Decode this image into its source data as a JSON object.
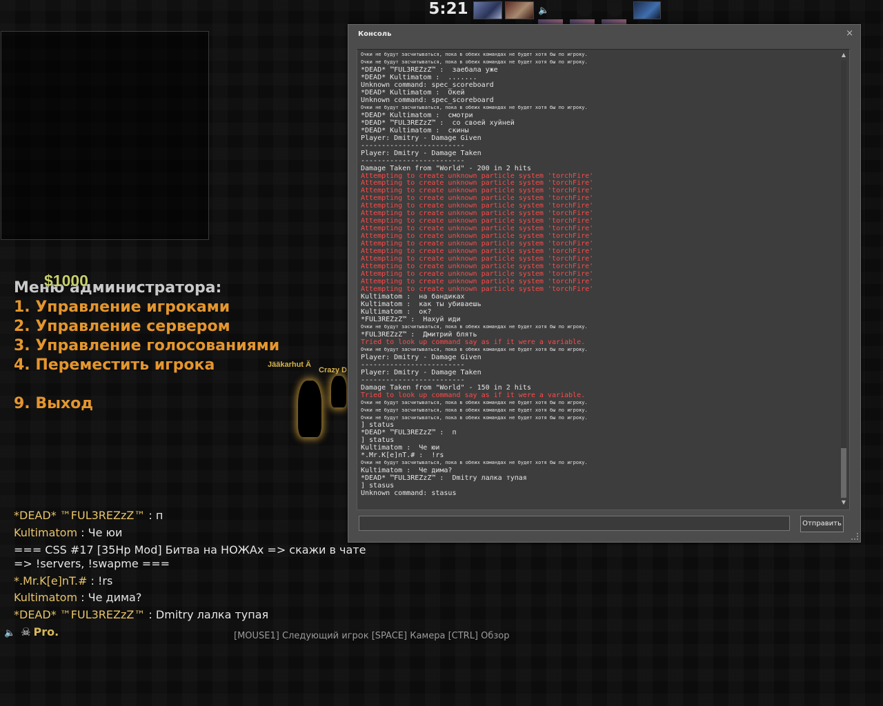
{
  "hud": {
    "timer": "5:21",
    "money": "$1000"
  },
  "admin_menu": {
    "title": "Меню администратора:",
    "items": [
      "1. Управление игроками",
      "2. Управление сервером",
      "3. Управление голосованиями",
      "4. Переместить игрока",
      "9. Выход"
    ]
  },
  "player_tags": [
    "Jääkarhut Ä",
    "Crazy D"
  ],
  "chat": {
    "lines": [
      {
        "name": "*DEAD* ™FUL3REZzZ™",
        "sep": " :  ",
        "text": "п"
      },
      {
        "name": "Kultimatom",
        "sep": " :  ",
        "text": "Че юи"
      },
      {
        "name": "",
        "sep": "",
        "text": "=== CSS #17 [35Hp Mod] Битва на НОЖАх => скажи в чате"
      },
      {
        "name": "",
        "sep": "",
        "text": "=> !servers, !swapme ==="
      },
      {
        "name": "*.Mr.K[e]nT.#",
        "sep": " :  ",
        "text": "!rs"
      },
      {
        "name": "Kultimatom",
        "sep": " :  ",
        "text": "Че дима?"
      },
      {
        "name": "*DEAD* ™FUL3REZzZ™",
        "sep": " :  ",
        "text": "Dmitry лалка тупая"
      }
    ],
    "voice_speaker": "Pro.",
    "controls_hint": "[MOUSE1] Следующий игрок [SPACE] Камера [CTRL] Обзор"
  },
  "console": {
    "title": "Консоль",
    "close_label": "×",
    "send_label": "Отправить",
    "input_value": "",
    "log": [
      {
        "text": "Очки не будут засчитываться, пока в обеих командах не будет хотя бы по игроку.",
        "style": "small"
      },
      {
        "text": "Очки не будут засчитываться, пока в обеих командах не будет хотя бы по игроку.",
        "style": "small"
      },
      {
        "text": "*DEAD* ™FUL3REZzZ™ :  заебала уже",
        "style": ""
      },
      {
        "text": "*DEAD* Kultimatom :  .......",
        "style": ""
      },
      {
        "text": "Unknown command: spec_scoreboard",
        "style": ""
      },
      {
        "text": "*DEAD* Kultimatom :  Окей",
        "style": ""
      },
      {
        "text": "Unknown command: spec_scoreboard",
        "style": ""
      },
      {
        "text": "Очки не будут засчитываться, пока в обеих командах не будет хотя бы по игроку.",
        "style": "small"
      },
      {
        "text": "*DEAD* Kultimatom :  смотри",
        "style": ""
      },
      {
        "text": "*DEAD* ™FUL3REZzZ™ :  со своей хуйней",
        "style": ""
      },
      {
        "text": "*DEAD* Kultimatom :  скины",
        "style": ""
      },
      {
        "text": "Player: Dmitry - Damage Given",
        "style": ""
      },
      {
        "text": "-------------------------",
        "style": ""
      },
      {
        "text": "Player: Dmitry - Damage Taken",
        "style": ""
      },
      {
        "text": "-------------------------",
        "style": ""
      },
      {
        "text": "Damage Taken from \"World\" - 200 in 2 hits",
        "style": ""
      },
      {
        "text": "Attempting to create unknown particle system 'torchFire'",
        "style": "red"
      },
      {
        "text": "Attempting to create unknown particle system 'torchFire'",
        "style": "red"
      },
      {
        "text": "Attempting to create unknown particle system 'torchFire'",
        "style": "red"
      },
      {
        "text": "Attempting to create unknown particle system 'torchFire'",
        "style": "red"
      },
      {
        "text": "Attempting to create unknown particle system 'torchFire'",
        "style": "red"
      },
      {
        "text": "Attempting to create unknown particle system 'torchFire'",
        "style": "red"
      },
      {
        "text": "Attempting to create unknown particle system 'torchFire'",
        "style": "red"
      },
      {
        "text": "Attempting to create unknown particle system 'torchFire'",
        "style": "red"
      },
      {
        "text": "Attempting to create unknown particle system 'torchFire'",
        "style": "red"
      },
      {
        "text": "Attempting to create unknown particle system 'torchFire'",
        "style": "red"
      },
      {
        "text": "Attempting to create unknown particle system 'torchFire'",
        "style": "red"
      },
      {
        "text": "Attempting to create unknown particle system 'torchFire'",
        "style": "red"
      },
      {
        "text": "Attempting to create unknown particle system 'torchFire'",
        "style": "red"
      },
      {
        "text": "Attempting to create unknown particle system 'torchFire'",
        "style": "red"
      },
      {
        "text": "Attempting to create unknown particle system 'torchFire'",
        "style": "red"
      },
      {
        "text": "Attempting to create unknown particle system 'torchFire'",
        "style": "red"
      },
      {
        "text": "Kultimatom :  на бандиках",
        "style": ""
      },
      {
        "text": "Kultimatom :  как ты убиваешь",
        "style": ""
      },
      {
        "text": "Kultimatom :  ок?",
        "style": ""
      },
      {
        "text": "*FUL3REZzZ™ :  Нахуй иди",
        "style": ""
      },
      {
        "text": "Очки не будут засчитываться, пока в обеих командах не будет хотя бы по игроку.",
        "style": "small"
      },
      {
        "text": "*FUL3REZzZ™ :  Дмитрий блять",
        "style": ""
      },
      {
        "text": "Tried to look up command say as if it were a variable.",
        "style": "red"
      },
      {
        "text": "Очки не будут засчитываться, пока в обеих командах не будет хотя бы по игроку.",
        "style": "small"
      },
      {
        "text": "Player: Dmitry - Damage Given",
        "style": ""
      },
      {
        "text": "-------------------------",
        "style": ""
      },
      {
        "text": "Player: Dmitry - Damage Taken",
        "style": ""
      },
      {
        "text": "-------------------------",
        "style": ""
      },
      {
        "text": "Damage Taken from \"World\" - 150 in 2 hits",
        "style": ""
      },
      {
        "text": "Tried to look up command say as if it were a variable.",
        "style": "red"
      },
      {
        "text": "Очки не будут засчитываться, пока в обеих командах не будет хотя бы по игроку.",
        "style": "small"
      },
      {
        "text": "Очки не будут засчитываться, пока в обеих командах не будет хотя бы по игроку.",
        "style": "small"
      },
      {
        "text": "Очки не будут засчитываться, пока в обеих командах не будет хотя бы по игроку.",
        "style": "small"
      },
      {
        "text": "] status",
        "style": ""
      },
      {
        "text": "*DEAD* ™FUL3REZzZ™ :  п",
        "style": ""
      },
      {
        "text": "] status",
        "style": ""
      },
      {
        "text": "Kultimatom :  Че юи",
        "style": ""
      },
      {
        "text": "*.Mr.K[e]nT.# :  !rs",
        "style": ""
      },
      {
        "text": "Очки не будут засчитываться, пока в обеих командах не будет хотя бы по игроку.",
        "style": "small"
      },
      {
        "text": "Kultimatom :  Че дима?",
        "style": ""
      },
      {
        "text": "*DEAD* ™FUL3REZzZ™ :  Dmitry лалка тупая",
        "style": ""
      },
      {
        "text": "] stasus",
        "style": ""
      },
      {
        "text": "Unknown command: stasus",
        "style": ""
      }
    ]
  }
}
